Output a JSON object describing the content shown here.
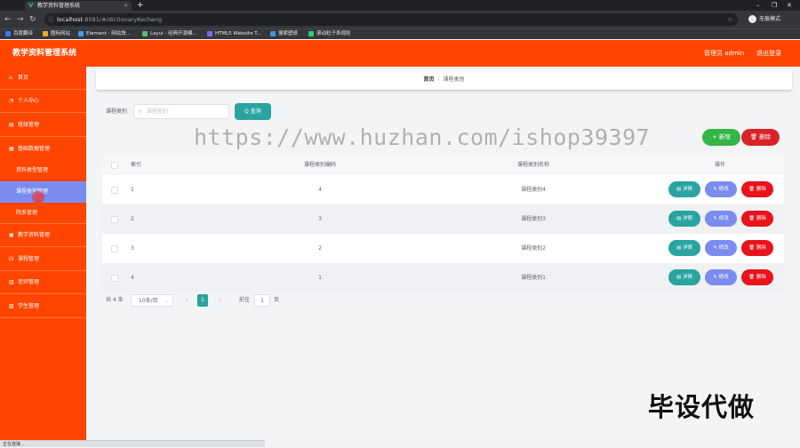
{
  "browser": {
    "tab_title": "教学资料管理系统",
    "tab_close": "×",
    "new_tab": "+",
    "url_host": "localhost",
    "url_path": ":8081/#/dictionaryKecheng",
    "incognito_label": "无痕模式",
    "bookmarks": [
      {
        "label": "百度翻译",
        "color": "#3b7cff"
      },
      {
        "label": "图标网站",
        "color": "#f5a623"
      },
      {
        "label": "Element - 网站快...",
        "color": "#409eff"
      },
      {
        "label": "Layui - 经典开源模...",
        "color": "#5fb878"
      },
      {
        "label": "HTML5 Website T...",
        "color": "#7b68ee"
      },
      {
        "label": "搜索壁纸",
        "color": "#4a90e2"
      },
      {
        "label": "滚动粒子系规则",
        "color": "#2ecc71"
      }
    ]
  },
  "header": {
    "title": "教学资料管理系统",
    "admin": "管理员 admin",
    "logout": "退出登录"
  },
  "sidebar": {
    "items": [
      {
        "label": "首页",
        "icon": "home-icon",
        "glyph": "⌂"
      },
      {
        "label": "个人中心",
        "icon": "user-icon",
        "glyph": "◔"
      },
      {
        "label": "班级管理",
        "icon": "class-icon",
        "glyph": "▤"
      },
      {
        "label": "基础数据管理",
        "icon": "data-icon",
        "glyph": "▦"
      }
    ],
    "sub_items": [
      {
        "label": "资料类型管理"
      },
      {
        "label": "课程类型管理"
      },
      {
        "label": "院系管理"
      }
    ],
    "items_after": [
      {
        "label": "教学资料管理",
        "icon": "doc-icon",
        "glyph": "▣"
      },
      {
        "label": "课程管理",
        "icon": "course-icon",
        "glyph": "☊"
      },
      {
        "label": "老师管理",
        "icon": "teacher-icon",
        "glyph": "▥"
      },
      {
        "label": "学生管理",
        "icon": "student-icon",
        "glyph": "▧"
      }
    ]
  },
  "breadcrumb": {
    "home": "首页",
    "separator": "/",
    "current": "课程类别"
  },
  "search": {
    "label": "课程类别",
    "placeholder": "课程类别",
    "query_button": "Q 查询"
  },
  "actions": {
    "add": "+ 新增",
    "delete": "删除"
  },
  "table": {
    "headers": [
      "索引",
      "课程类别编码",
      "课程类别名称",
      "操作"
    ],
    "rows": [
      {
        "index": "1",
        "code": "4",
        "name": "课程类别4"
      },
      {
        "index": "2",
        "code": "3",
        "name": "课程类别3"
      },
      {
        "index": "3",
        "code": "2",
        "name": "课程类别2"
      },
      {
        "index": "4",
        "code": "1",
        "name": "课程类别1"
      }
    ],
    "op_detail": "详情",
    "op_edit": "修改",
    "op_delete": "删除"
  },
  "pagination": {
    "total": "共 4 条",
    "page_size": "10条/页",
    "prev": "<",
    "current": "1",
    "next": ">",
    "goto_label": "前往",
    "goto_value": "1",
    "page_unit": "页"
  },
  "overlay": {
    "watermark": "https://www.huzhan.com/ishop39397",
    "corner_text": "毕设代做",
    "status": "正在连接..."
  }
}
